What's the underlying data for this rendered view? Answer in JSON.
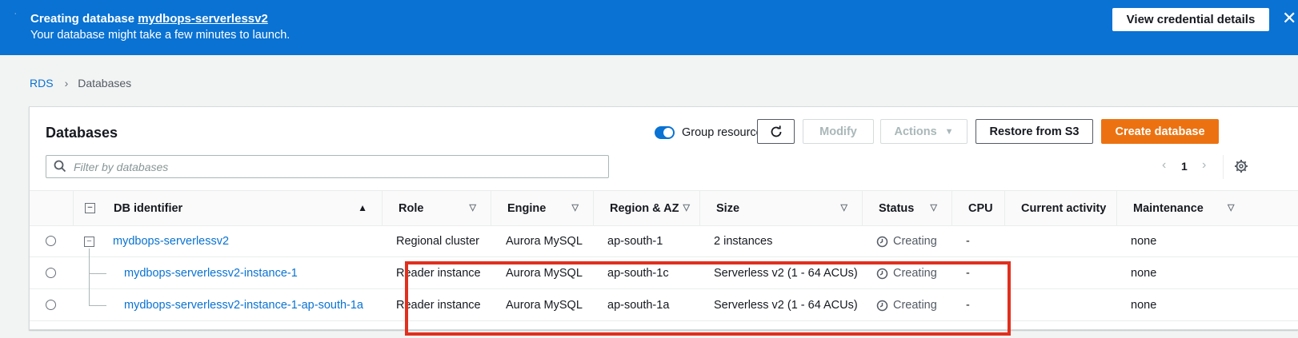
{
  "flash": {
    "title_prefix": "Creating database",
    "title_link": "mydbops-serverlessv2",
    "message": "Your database might take a few minutes to launch.",
    "button_label": "View credential details",
    "close_glyph": "✕"
  },
  "breadcrumb": {
    "root": "RDS",
    "separator": "›",
    "current": "Databases"
  },
  "panel": {
    "title": "Databases",
    "group_toggle_label": "Group resources",
    "group_toggle_on": true,
    "refresh_icon": "refresh-icon",
    "modify_label": "Modify",
    "actions_label": "Actions",
    "restore_label": "Restore from S3",
    "create_label": "Create database",
    "filter_placeholder": "Filter by databases",
    "pager": {
      "prev": "‹",
      "page": "1",
      "next": "›"
    }
  },
  "table": {
    "headers": {
      "identifier": "DB identifier",
      "role": "Role",
      "engine": "Engine",
      "region": "Region & AZ",
      "size": "Size",
      "status": "Status",
      "cpu": "CPU",
      "activity": "Current activity",
      "maintenance": "Maintenance"
    },
    "rows": [
      {
        "identifier": "mydbops-serverlessv2",
        "role": "Regional cluster",
        "engine": "Aurora MySQL",
        "region": "ap-south-1",
        "size": "2 instances",
        "status": "Creating",
        "cpu": "-",
        "activity": "",
        "maintenance": "none"
      },
      {
        "identifier": "mydbops-serverlessv2-instance-1",
        "role": "Reader instance",
        "engine": "Aurora MySQL",
        "region": "ap-south-1c",
        "size": "Serverless v2 (1 - 64 ACUs)",
        "status": "Creating",
        "cpu": "-",
        "activity": "",
        "maintenance": "none"
      },
      {
        "identifier": "mydbops-serverlessv2-instance-1-ap-south-1a",
        "role": "Reader instance",
        "engine": "Aurora MySQL",
        "region": "ap-south-1a",
        "size": "Serverless v2 (1 - 64 ACUs)",
        "status": "Creating",
        "cpu": "-",
        "activity": "",
        "maintenance": "none"
      }
    ]
  },
  "colors": {
    "flash_bg": "#0972d3",
    "primary_button": "#ec7211",
    "link": "#0972d3",
    "highlight_box": "#e0301e"
  }
}
